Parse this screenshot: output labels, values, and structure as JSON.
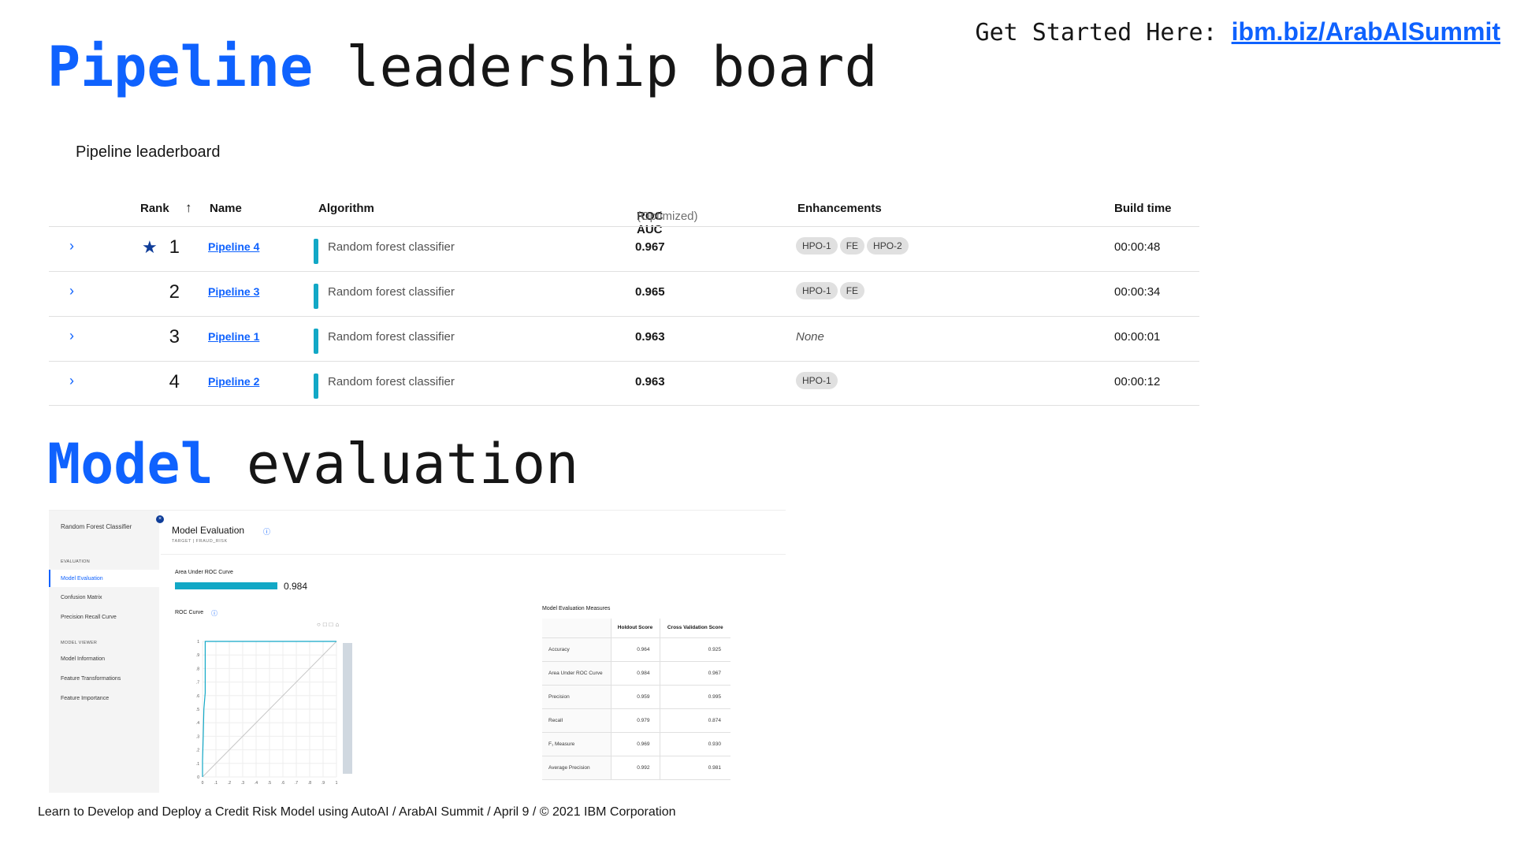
{
  "top": {
    "prefix": "Get Started Here: ",
    "link": "ibm.biz/ArabAISummit"
  },
  "headings": {
    "pipeline_accent": "Pipeline",
    "pipeline_rest": " leadership board",
    "model_accent": "Model",
    "model_rest": " evaluation"
  },
  "leaderboard": {
    "title": "Pipeline leaderboard",
    "columns": {
      "rank": "Rank",
      "sort_arrow": "↑",
      "name": "Name",
      "algorithm": "Algorithm",
      "roc": "ROC AUC",
      "roc_note": "(Optimized)",
      "enhancements": "Enhancements",
      "build_time": "Build time"
    },
    "rows": [
      {
        "rank": "1",
        "starred": true,
        "name": "Pipeline 4",
        "algorithm": "Random forest classifier",
        "auc": "0.967",
        "tags": [
          "HPO-1",
          "FE",
          "HPO-2"
        ],
        "time": "00:00:48"
      },
      {
        "rank": "2",
        "starred": false,
        "name": "Pipeline 3",
        "algorithm": "Random forest classifier",
        "auc": "0.965",
        "tags": [
          "HPO-1",
          "FE"
        ],
        "time": "00:00:34"
      },
      {
        "rank": "3",
        "starred": false,
        "name": "Pipeline 1",
        "algorithm": "Random forest classifier",
        "auc": "0.963",
        "tags": [],
        "none": "None",
        "time": "00:00:01"
      },
      {
        "rank": "4",
        "starred": false,
        "name": "Pipeline 2",
        "algorithm": "Random forest classifier",
        "auc": "0.963",
        "tags": [
          "HPO-1"
        ],
        "time": "00:00:12"
      }
    ]
  },
  "model_eval": {
    "sidebar": {
      "title": "Random Forest Classifier",
      "section_evaluation": "EVALUATION",
      "item_model_evaluation": "Model Evaluation",
      "item_confusion": "Confusion Matrix",
      "item_precision_recall": "Precision Recall Curve",
      "section_viewer": "MODEL VIEWER",
      "item_model_info": "Model Information",
      "item_feature_transform": "Feature Transformations",
      "item_feature_importance": "Feature Importance"
    },
    "title": "Model Evaluation",
    "subtitle": "TARGET | FRAUD_RISK",
    "auc_label": "Area Under ROC Curve",
    "auc_value": "0.984",
    "auc_fraction": 0.984,
    "roc_label": "ROC Curve",
    "roc_ticks": [
      "0",
      ".1",
      ".2",
      ".3",
      ".4",
      ".5",
      ".6",
      ".7",
      ".8",
      ".9",
      "1"
    ],
    "measures_title": "Model Evaluation Measures",
    "measures_headers": [
      "",
      "Holdout Score",
      "Cross Validation Score"
    ],
    "measures": [
      {
        "name": "Accuracy",
        "holdout": "0.964",
        "cv": "0.925"
      },
      {
        "name": "Area Under ROC Curve",
        "holdout": "0.984",
        "cv": "0.967"
      },
      {
        "name": "Precision",
        "holdout": "0.959",
        "cv": "0.995"
      },
      {
        "name": "Recall",
        "holdout": "0.979",
        "cv": "0.874"
      },
      {
        "name": "F₁ Measure",
        "holdout": "0.969",
        "cv": "0.930"
      },
      {
        "name": "Average Precision",
        "holdout": "0.992",
        "cv": "0.981"
      }
    ]
  },
  "footer": "Learn to Develop and Deploy a Credit Risk Model using AutoAI / ArabAI Summit / April 9 / © 2021 IBM Corporation",
  "colors": {
    "accent": "#0f62fe",
    "teal": "#12a8c6"
  }
}
